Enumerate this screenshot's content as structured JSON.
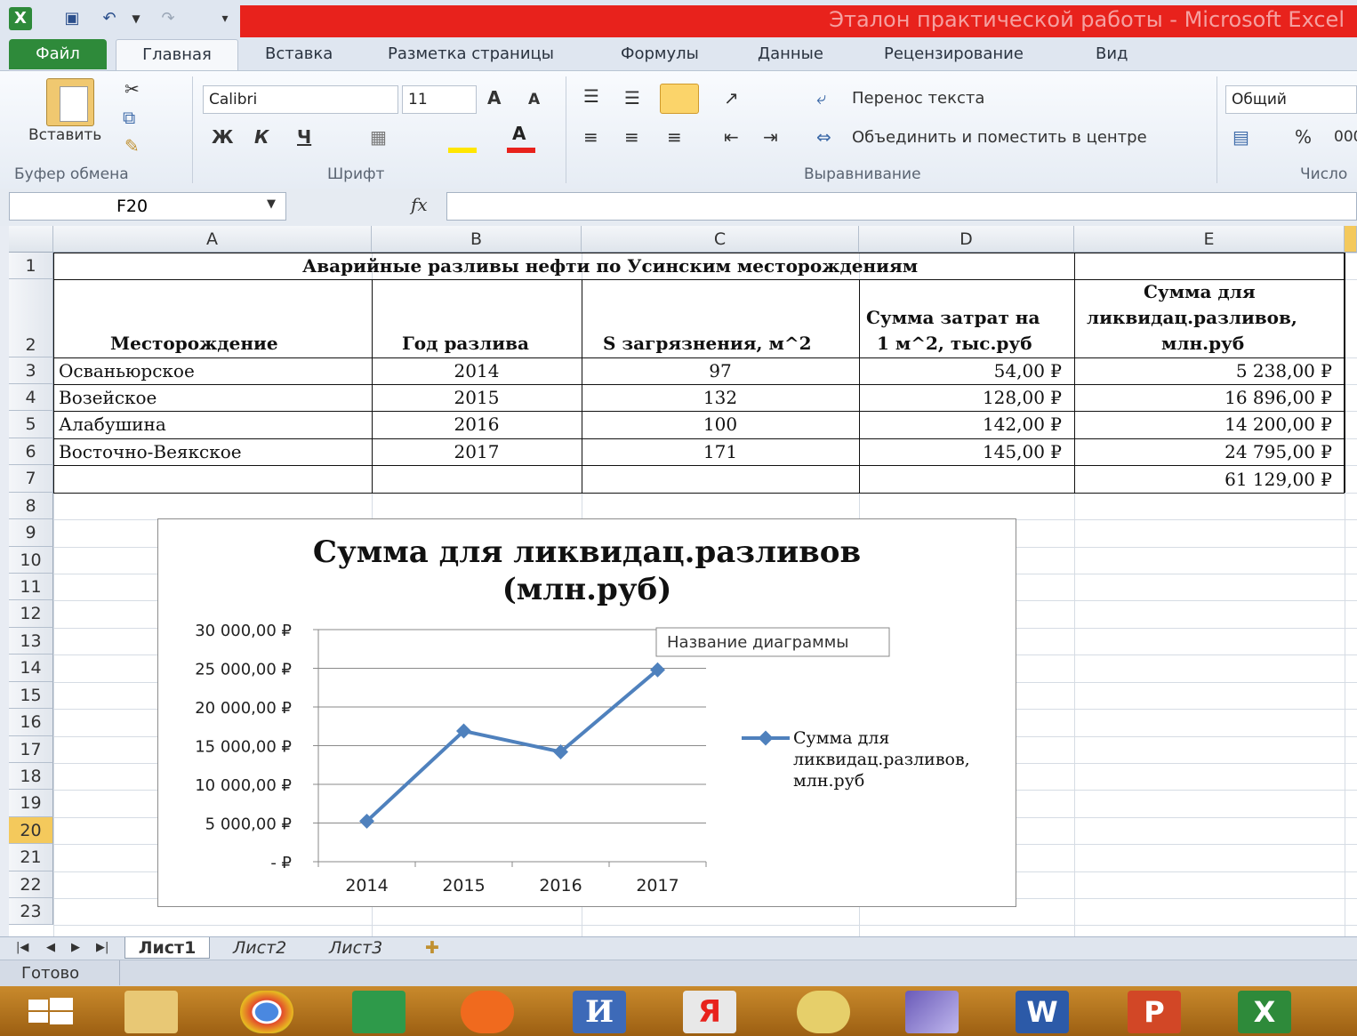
{
  "window": {
    "title": "Эталон практической работы  -  Microsoft Excel"
  },
  "tabs": [
    "Файл",
    "Главная",
    "Вставка",
    "Разметка страницы",
    "Формулы",
    "Данные",
    "Рецензирование",
    "Вид"
  ],
  "ribbon": {
    "paste_label": "Вставить",
    "clipboard_group": "Буфер обмена",
    "font_name": "Calibri",
    "font_size": "11",
    "bold": "Ж",
    "italic": "К",
    "underline": "Ч",
    "font_group": "Шрифт",
    "wrap_text": "Перенос текста",
    "merge_center": "Объединить и поместить в центре",
    "alignment_group": "Выравнивание",
    "number_format": "Общий",
    "percent": "%",
    "thousands": "000",
    "number_group": "Число"
  },
  "formula_bar": {
    "name_box": "F20",
    "fx": "fx",
    "formula": ""
  },
  "columns": [
    "A",
    "B",
    "C",
    "D",
    "E"
  ],
  "rows": [
    "1",
    "2",
    "3",
    "4",
    "5",
    "6",
    "7",
    "8",
    "9",
    "10",
    "11",
    "12",
    "13",
    "14",
    "15",
    "16",
    "17",
    "18",
    "19",
    "20",
    "21",
    "22",
    "23"
  ],
  "sheet": {
    "title": "Аварийные разливы нефти по Усинским месторождениям",
    "headers": {
      "a": "Месторождение",
      "b": "Год разлива",
      "c": "S загрязнения, м^2",
      "d1": "Сумма затрат на",
      "d2": "1 м^2, тыс.руб",
      "e1": "Сумма для",
      "e2": "ликвидац.разливов,",
      "e3": "млн.руб"
    },
    "rows": [
      {
        "field": "Осваньюрское",
        "year": "2014",
        "area": "97",
        "cost": "54,00 ₽",
        "total": "5 238,00 ₽"
      },
      {
        "field": "Возейское",
        "year": "2015",
        "area": "132",
        "cost": "128,00 ₽",
        "total": "16 896,00 ₽"
      },
      {
        "field": "Алабушина",
        "year": "2016",
        "area": "100",
        "cost": "142,00 ₽",
        "total": "14 200,00 ₽"
      },
      {
        "field": "Восточно-Веякское",
        "year": "2017",
        "area": "171",
        "cost": "145,00 ₽",
        "total": "24 795,00 ₽"
      }
    ],
    "grand_total": "61 129,00 ₽"
  },
  "chart_data": {
    "type": "line",
    "title": "Сумма для ликвидац.разливов (млн.руб)",
    "title_line1": "Сумма для ликвидац.разливов",
    "title_line2": "(млн.руб)",
    "categories": [
      "2014",
      "2015",
      "2016",
      "2017"
    ],
    "series": [
      {
        "name": "Сумма для ликвидац.разливов, млн.руб",
        "values": [
          5238,
          16896,
          14200,
          24795
        ]
      }
    ],
    "legend_lines": [
      "Сумма для",
      "ликвидац.разливов,",
      "млн.руб"
    ],
    "y_ticks": [
      "30 000,00 ₽",
      "25 000,00 ₽",
      "20 000,00 ₽",
      "15 000,00 ₽",
      "10 000,00 ₽",
      "5 000,00 ₽",
      "-  ₽"
    ],
    "ylim": [
      0,
      30000
    ],
    "grid": true,
    "legend_position": "right",
    "tooltip": "Название диаграммы",
    "color": "#4f81bd"
  },
  "sheet_tabs": [
    "Лист1",
    "Лист2",
    "Лист3"
  ],
  "status": "Готово",
  "colors": {
    "title_bar": "#e8221c",
    "file_tab": "#2e8a3a",
    "taskbar": "#b07420"
  }
}
